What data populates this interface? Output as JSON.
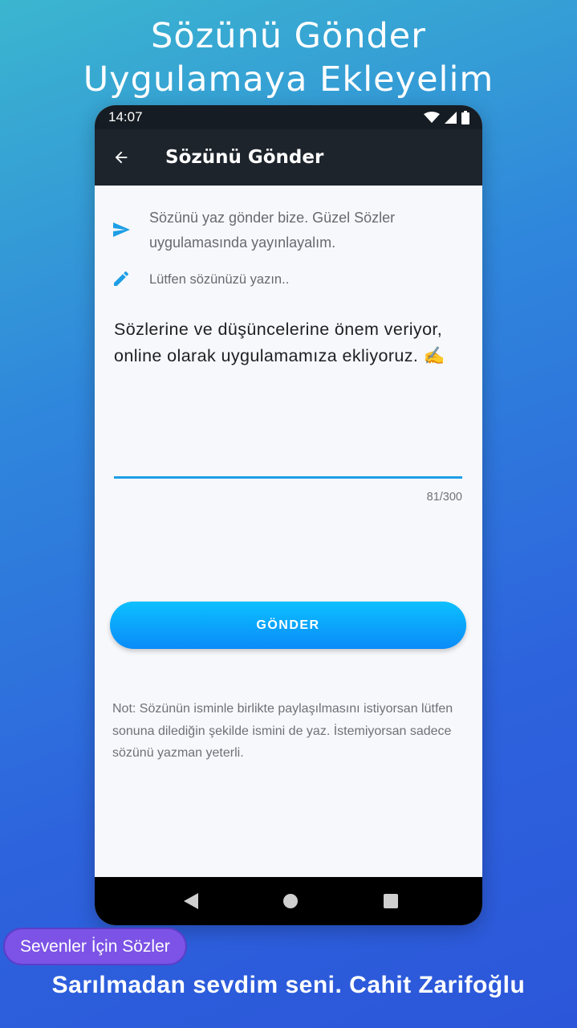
{
  "promo": {
    "headline_line1": "Sözünü Gönder",
    "headline_line2": "Uygulamaya Ekleyelim",
    "badge": "Sevenler İçin Sözler",
    "caption": "Sarılmadan sevdim seni. Cahit Zarifoğlu"
  },
  "status_bar": {
    "time": "14:07",
    "icons": [
      "wifi-icon",
      "signal-icon",
      "battery-icon"
    ]
  },
  "app_bar": {
    "title": "Sözünü Gönder",
    "back_icon": "arrow-back-icon"
  },
  "form": {
    "intro_icon": "send-icon",
    "intro_text": "Sözünü yaz gönder bize. Güzel Sözler uygulamasında yayınlayalım.",
    "hint_icon": "pencil-icon",
    "hint_text": "Lütfen sözünüzü yazın..",
    "input_value": "Sözlerine ve düşüncelerine önem veriyor, online olarak uygulamamıza ekliyoruz. ✍️",
    "counter": "81/300",
    "send_label": "GÖNDER",
    "note": "Not: Sözünün isminle birlikte paylaşılmasını istiyorsan lütfen sonuna dilediğin şekilde ismini de yaz. İstemiyorsan sadece sözünü yazman yeterli."
  },
  "nav_bar": {
    "icons": [
      "nav-back-icon",
      "nav-home-icon",
      "nav-recents-icon"
    ]
  },
  "colors": {
    "accent": "#1d9fe6",
    "app_bar": "#1e242c",
    "badge": "#7c53e6"
  }
}
